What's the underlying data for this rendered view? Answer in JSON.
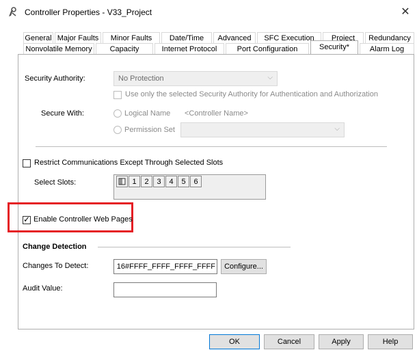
{
  "window": {
    "title": "Controller Properties - V33_Project",
    "close_glyph": "✕"
  },
  "tabs_row1": [
    "General",
    "Major Faults",
    "Minor Faults",
    "Date/Time",
    "Advanced",
    "SFC Execution",
    "Project",
    "Redundancy"
  ],
  "tabs_row2": [
    "Nonvolatile Memory",
    "Capacity",
    "Internet Protocol",
    "Port Configuration",
    "Security*",
    "Alarm Log"
  ],
  "security": {
    "authority_label": "Security Authority:",
    "authority_value": "No Protection",
    "use_only_label": "Use only the selected Security Authority for Authentication and Authorization",
    "secure_with_label": "Secure With:",
    "logical_name_label": "Logical Name",
    "controller_name_placeholder": "<Controller Name>",
    "permission_set_label": "Permission Set",
    "restrict_label": "Restrict Communications Except Through Selected Slots",
    "select_slots_label": "Select Slots:",
    "slots": [
      "1",
      "2",
      "3",
      "4",
      "5",
      "6"
    ],
    "enable_web_label": "Enable Controller Web Pages",
    "enable_web_checked": true,
    "change_detection_heading": "Change Detection",
    "changes_to_detect_label": "Changes To Detect:",
    "changes_value": "16#FFFF_FFFF_FFFF_FFFF",
    "configure_label": "Configure...",
    "audit_value_label": "Audit Value:",
    "audit_value": ""
  },
  "buttons": {
    "ok": "OK",
    "cancel": "Cancel",
    "apply": "Apply",
    "help": "Help"
  },
  "colors": {
    "highlight": "#e51e25",
    "default_button_border": "#0078d7"
  }
}
